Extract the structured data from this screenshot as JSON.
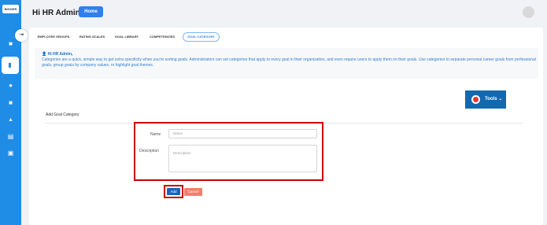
{
  "sidebar": {
    "logo_text": "BIGGER",
    "icons": [
      "home-icon",
      "goals-icon",
      "people-icon",
      "reports-icon",
      "analytics-icon",
      "documents-icon",
      "calendar-icon"
    ]
  },
  "header": {
    "greeting": "Hi HR Admin",
    "home_label": "Home"
  },
  "tabs": [
    {
      "label": "EMPLOYEE GROUPS",
      "active": false
    },
    {
      "label": "RATING SCALES",
      "active": false
    },
    {
      "label": "GOAL LIBRARY",
      "active": false
    },
    {
      "label": "COMPETENCIES",
      "active": false
    },
    {
      "label": "GOAL CATEGORY",
      "active": true
    }
  ],
  "info": {
    "person": "Hi HR Admin",
    "suffix": ",",
    "text": "Categories are a quick, simple way to get extra specificity when you're sorting goals. Administrators can set categories that apply to every goal in their organization, and even require users to apply them on their goals. Use categories to separate personal career goals from professional goals, group goals by company values, or highlight goal themes."
  },
  "tools": {
    "label": "Tools"
  },
  "section": {
    "title": "Add Goal Category"
  },
  "form": {
    "name_label": "Name",
    "name_placeholder": "Name",
    "description_label": "Description",
    "description_placeholder": "Description",
    "add_label": "Add",
    "cancel_label": "Cancel"
  },
  "colors": {
    "sidebar": "#1f8ce6",
    "primary": "#2f80ed",
    "highlight": "#cc0000",
    "cancel": "#f0806a",
    "tools": "#1468b0"
  }
}
